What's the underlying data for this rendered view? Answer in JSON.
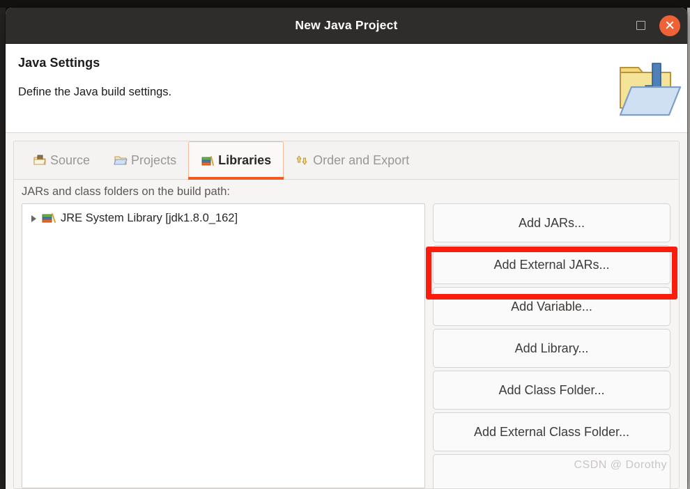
{
  "window": {
    "title": "New Java Project",
    "controls": {
      "maximize": "maximize-button",
      "close": "close-button"
    }
  },
  "header": {
    "title": "Java Settings",
    "description": "Define the Java build settings.",
    "icon": "java-project-folder-icon"
  },
  "tabs": [
    {
      "label": "Source",
      "icon": "source-folder-icon",
      "active": false
    },
    {
      "label": "Projects",
      "icon": "projects-folder-icon",
      "active": false
    },
    {
      "label": "Libraries",
      "icon": "libraries-books-icon",
      "active": true
    },
    {
      "label": "Order and Export",
      "icon": "order-export-arrows-icon",
      "active": false
    }
  ],
  "libraries_tab": {
    "tree_label": "JARs and class folders on the build path:",
    "tree_items": [
      {
        "label": "JRE System Library [jdk1.8.0_162]",
        "icon": "libraries-books-icon",
        "expanded": false
      }
    ],
    "buttons": [
      {
        "label": "Add JARs...",
        "highlighted": false
      },
      {
        "label": "Add External JARs...",
        "highlighted": true
      },
      {
        "label": "Add Variable...",
        "highlighted": false
      },
      {
        "label": "Add Library...",
        "highlighted": false
      },
      {
        "label": "Add Class Folder...",
        "highlighted": false
      },
      {
        "label": "Add External Class Folder...",
        "highlighted": false
      },
      {
        "label": "",
        "highlighted": false
      }
    ]
  },
  "annotation": {
    "highlight_color": "#fa1c0c",
    "target_button": "Add External JARs..."
  },
  "watermark": "CSDN @  Dorothy",
  "colors": {
    "titlebar_bg": "#2f2d2c",
    "close_button": "#ef6237",
    "accent": "#f15a22",
    "panel_bg": "#f6f5f4",
    "tree_bg": "#ffffff"
  }
}
